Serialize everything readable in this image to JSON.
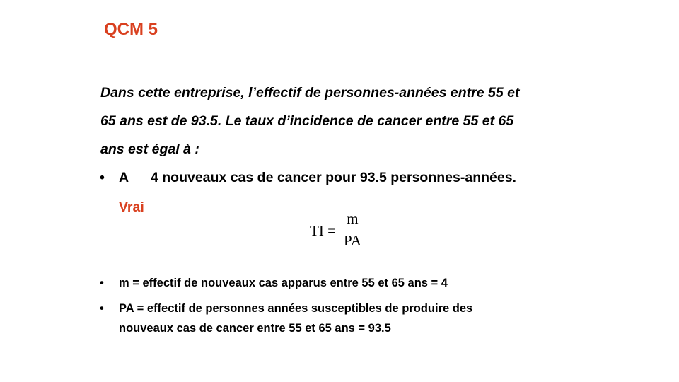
{
  "slide": {
    "title": "QCM 5",
    "question_lines": [
      "Dans cette entreprise, l’effectif de personnes-années  entre 55 et",
      "65 ans est de 93.5. Le taux d’incidence  de cancer entre 55 et 65",
      "ans est égal à :"
    ],
    "answer": {
      "bullet": "•",
      "letter": "A",
      "text": "4 nouveaux cas de cancer pour 93.5 personnes-années."
    },
    "verdict": "Vrai",
    "formula": {
      "lhs": "TI =",
      "numerator": "m",
      "denominator": "PA"
    },
    "definitions": [
      {
        "bullet": "•",
        "lines": [
          "m = effectif de nouveaux cas apparus entre 55 et 65 ans = 4"
        ]
      },
      {
        "bullet": "•",
        "lines": [
          "PA = effectif de personnes années susceptibles de produire des",
          "nouveaux cas de cancer entre 55 et 65 ans = 93.5"
        ]
      }
    ],
    "colors": {
      "accent": "#d9401f",
      "text": "#000000",
      "background": "#ffffff"
    }
  }
}
